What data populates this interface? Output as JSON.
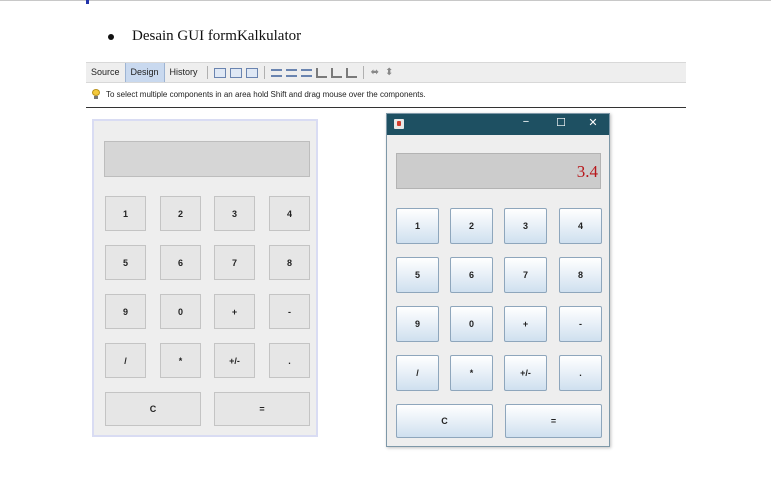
{
  "document": {
    "heading": "Desain GUI formKalkulator"
  },
  "designer_toolbar": {
    "tabs": [
      "Source",
      "Design",
      "History"
    ],
    "active_tab": "Design",
    "hint_text": "To select multiple components in an area hold Shift and drag mouse over the components.",
    "hint_icon": "lightbulb-icon"
  },
  "design_form": {
    "display_value": "",
    "buttons": [
      "1",
      "2",
      "3",
      "4",
      "5",
      "6",
      "7",
      "8",
      "9",
      "0",
      "+",
      "-",
      "/",
      "*",
      "+/-",
      "."
    ],
    "bottom_buttons": [
      "C",
      "="
    ]
  },
  "running_window": {
    "title_icon": "java-app-icon",
    "controls": {
      "minimize": "−",
      "maximize": "☐",
      "close": "✕"
    },
    "display_value": "3.4",
    "buttons": [
      "1",
      "2",
      "3",
      "4",
      "5",
      "6",
      "7",
      "8",
      "9",
      "0",
      "+",
      "-",
      "/",
      "*",
      "+/-",
      "."
    ],
    "bottom_buttons": [
      "C",
      "="
    ]
  },
  "colors": {
    "title_bar": "#1e5062",
    "display_text": "#b8171b",
    "tab_active": "#c9d9ef"
  }
}
